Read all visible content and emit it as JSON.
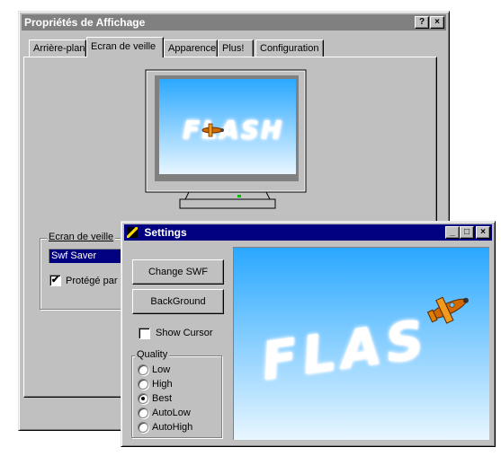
{
  "display_window": {
    "title": "Propriétés de Affichage",
    "help_btn": "?",
    "close_btn": "×",
    "tabs": [
      "Arrière-plan",
      "Ecran de veille",
      "Apparence",
      "Plus!",
      "Configuration"
    ],
    "monitor_preview_text": "FLASH",
    "screensaver_group_label": "Ecran de veille",
    "screensaver_value": "Swf Saver",
    "password_label": "Protégé par p",
    "password_checked": true
  },
  "settings_window": {
    "title": "Settings",
    "min_btn": "_",
    "max_btn": "□",
    "close_btn": "×",
    "change_swf_label": "Change SWF",
    "background_label": "BackGround",
    "show_cursor_label": "Show Cursor",
    "show_cursor_checked": false,
    "quality_label": "Quality",
    "quality_options": [
      "Low",
      "High",
      "Best",
      "AutoLow",
      "AutoHigh"
    ],
    "quality_selected": "Best",
    "preview_text": "FLAS"
  },
  "colors": {
    "titlebar_active": "#000080",
    "titlebar_inactive": "#808080",
    "face": "#c0c0c0",
    "desktop_teal": "#008080"
  }
}
